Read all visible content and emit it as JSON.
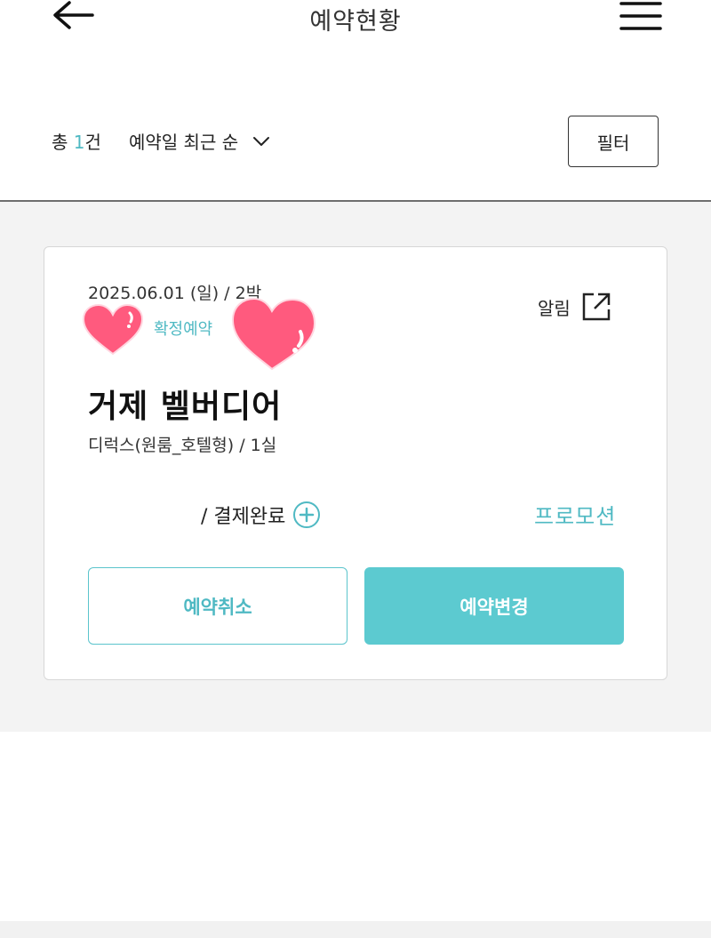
{
  "header": {
    "title": "예약현황",
    "back_icon": "arrow-left-icon",
    "menu_icon": "hamburger-menu-icon"
  },
  "toolbar": {
    "count_prefix": "총 ",
    "count_value": "1",
    "count_suffix": "건",
    "sort_label": "예약일 최근 순",
    "filter_label": "필터"
  },
  "reservation": {
    "date": "2025.06.01 (일) / 2박",
    "status": "확정예약",
    "alarm_label": "알림",
    "hotel_name": "거제 벨버디어",
    "room": "디럭스(원룸_호텔형) / 1실",
    "payment": "/ 결제완료",
    "promotion": "프로모션",
    "cancel_label": "예약취소",
    "change_label": "예약변경"
  },
  "colors": {
    "accent": "#4fb9c3",
    "primary_button": "#5ccad0",
    "sticker": "#ff5a7e"
  }
}
